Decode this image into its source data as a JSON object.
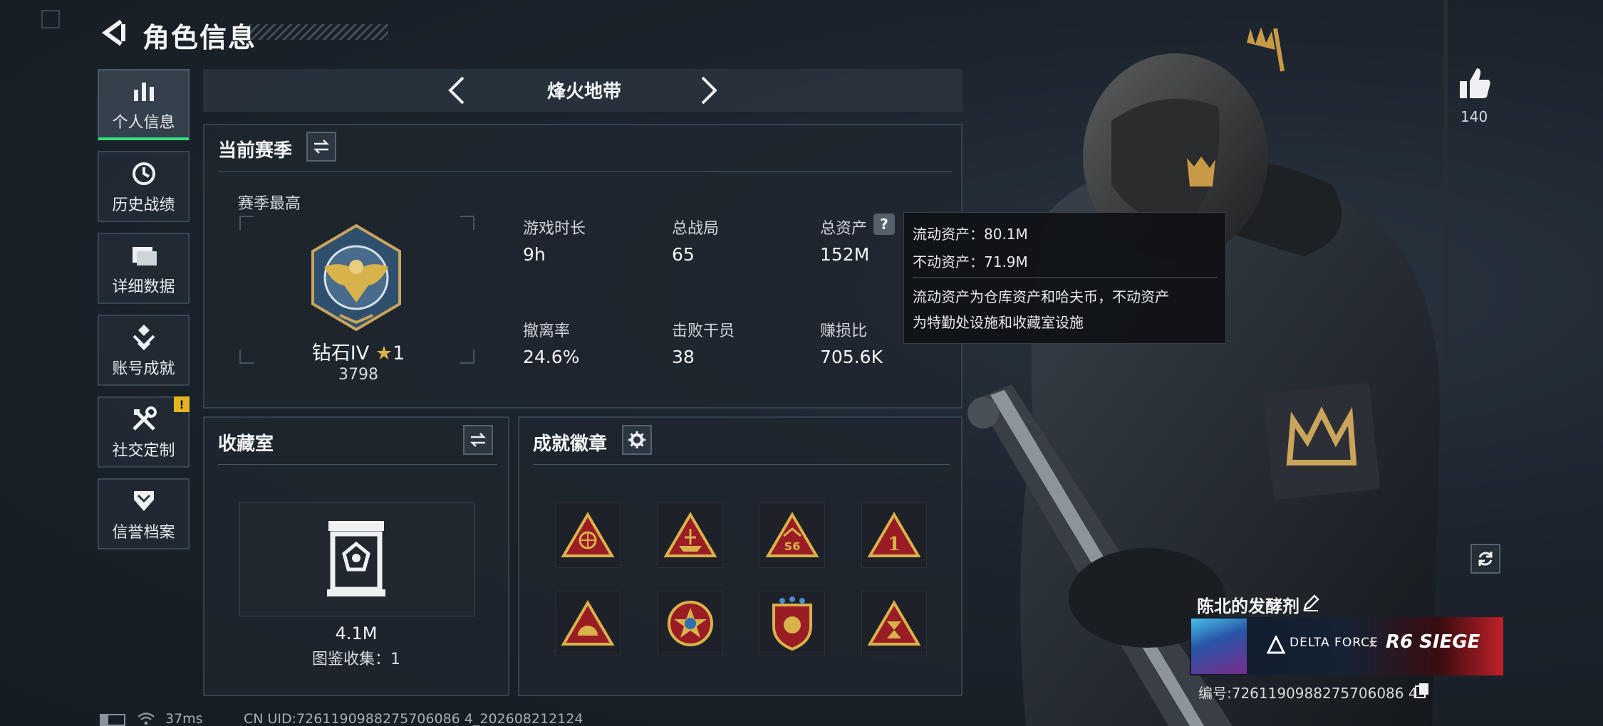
{
  "header": {
    "title": "角色信息"
  },
  "nav": {
    "items": [
      {
        "label": "个人信息",
        "icon": "bar-chart-icon"
      },
      {
        "label": "历史战绩",
        "icon": "history-icon"
      },
      {
        "label": "详细数据",
        "icon": "folder-icon"
      },
      {
        "label": "账号成就",
        "icon": "achievement-icon"
      },
      {
        "label": "社交定制",
        "icon": "tools-icon",
        "badge": "!"
      },
      {
        "label": "信誉档案",
        "icon": "shield-chevron-icon"
      }
    ]
  },
  "mode": {
    "title": "烽火地带"
  },
  "season": {
    "title": "当前赛季",
    "best_label": "赛季最高",
    "rank_name": "钻石IV",
    "rank_stars": "1",
    "rank_score": "3798",
    "stats": [
      {
        "label": "游戏时长",
        "value": "9h"
      },
      {
        "label": "总战局",
        "value": "65"
      },
      {
        "label": "总资产",
        "value": "152M"
      },
      {
        "label": "撤离率",
        "value": "24.6%"
      },
      {
        "label": "击败干员",
        "value": "38"
      },
      {
        "label": "赚损比",
        "value": "705.6K"
      }
    ]
  },
  "tooltip": {
    "line1": "流动资产：80.1M",
    "line2": "不动资产：71.9M",
    "desc1": "流动资产为仓库资产和哈夫币，不动资产",
    "desc2": "为特勤处设施和收藏室设施"
  },
  "collection": {
    "title": "收藏室",
    "value": "4.1M",
    "count_text": "图鉴收集：1"
  },
  "achievements": {
    "title": "成就徽章",
    "badges": [
      "triangle-badge-globe",
      "triangle-badge-ship",
      "triangle-badge-s6",
      "triangle-badge-1",
      "triangle-badge-half-sun",
      "round-star-badge",
      "shield-emblem-badge",
      "triangle-badge-hourglass"
    ]
  },
  "profile": {
    "likes": "140",
    "name": "陈北的发酵剂",
    "banner_brand": "DELTA FORCE",
    "banner_x": "×",
    "banner_r6": "R6 SIEGE",
    "id_text": "编号:7261190988275706086 4"
  },
  "status": {
    "ping": "37ms",
    "uid": "CN UID:7261190988275706086 4_202608212124"
  },
  "colors": {
    "accent_green": "#2fe07a",
    "gold": "#d8b24a",
    "badge_red": "#b4212a",
    "warn_yellow": "#e6b422"
  }
}
